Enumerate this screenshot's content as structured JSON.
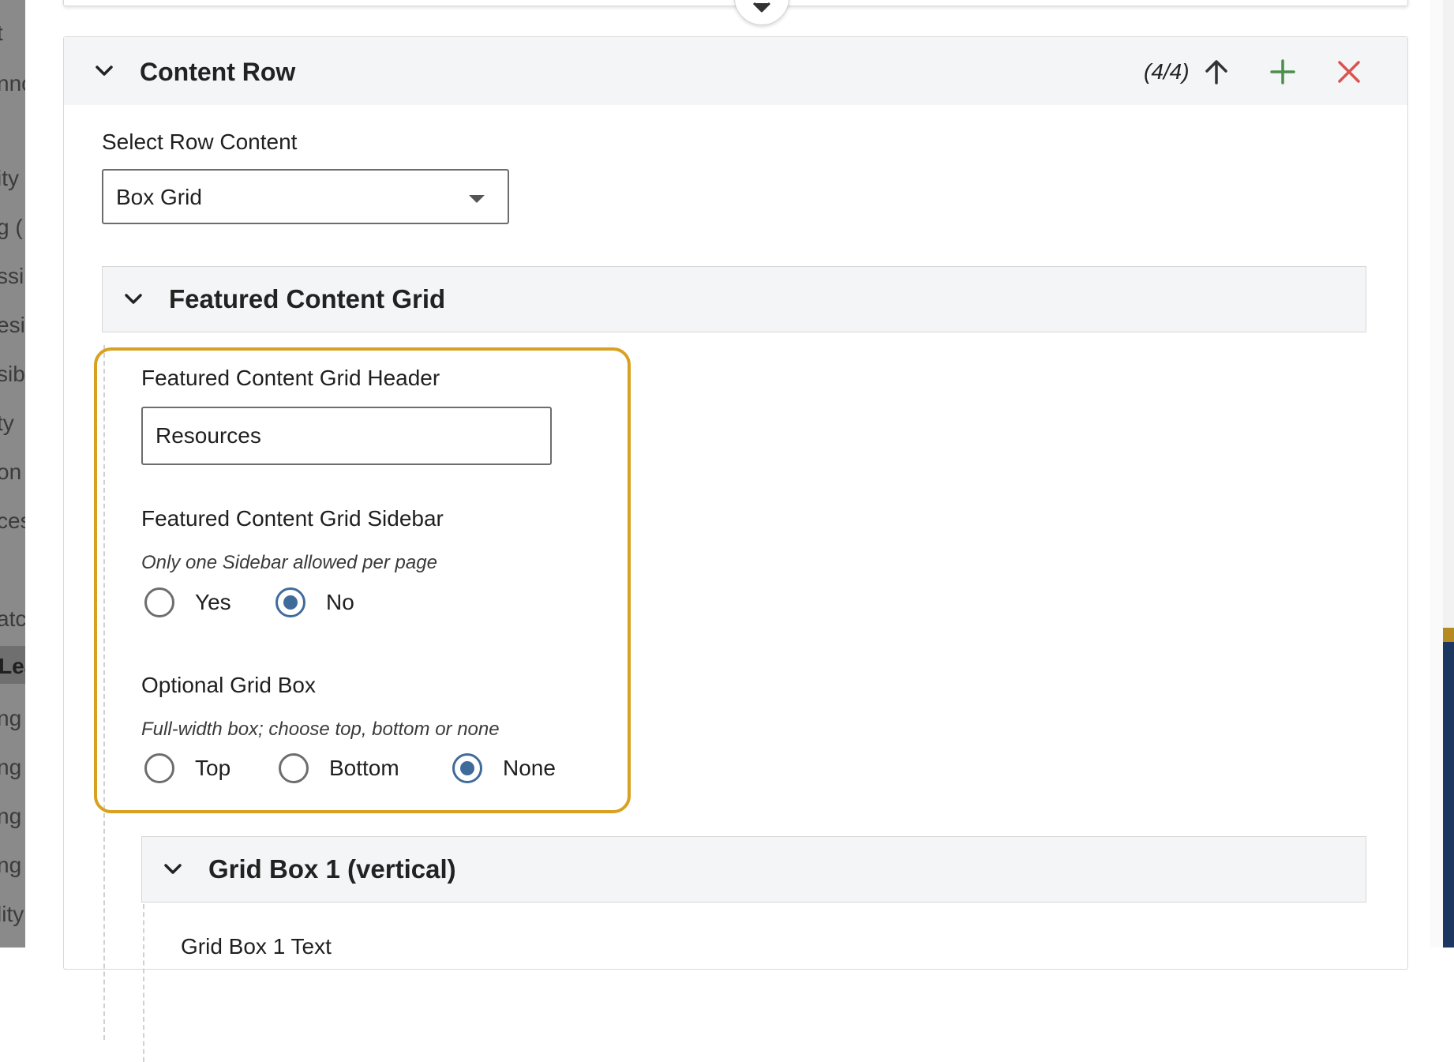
{
  "backdrop_fragments": [
    "t",
    "nno",
    "ity",
    "g (",
    "ssi",
    "esi",
    "sib",
    "ty",
    "on",
    "ces",
    "atc",
    "Lea",
    "ng a",
    "ng l",
    "ng",
    "ng",
    "lity"
  ],
  "content_row": {
    "title": "Content Row",
    "count": "(4/4)",
    "select_label": "Select Row Content",
    "select_value": "Box Grid"
  },
  "featured_grid": {
    "title": "Featured Content Grid",
    "header_label": "Featured Content Grid Header",
    "header_value": "Resources",
    "sidebar_label": "Featured Content Grid Sidebar",
    "sidebar_hint": "Only one Sidebar allowed per page",
    "sidebar_options": [
      {
        "label": "Yes",
        "selected": false
      },
      {
        "label": "No",
        "selected": true
      }
    ],
    "optional_label": "Optional Grid Box",
    "optional_hint": "Full-width box; choose top, bottom or none",
    "optional_options": [
      {
        "label": "Top",
        "selected": false
      },
      {
        "label": "Bottom",
        "selected": false
      },
      {
        "label": "None",
        "selected": true
      }
    ]
  },
  "grid_box_1": {
    "title": "Grid Box 1 (vertical)",
    "text_label": "Grid Box 1 Text"
  },
  "colors": {
    "highlight": "#d9a121",
    "radio_selected": "#3f6b9a",
    "add_icon": "#4a8f4a",
    "remove_icon": "#d9534f"
  }
}
